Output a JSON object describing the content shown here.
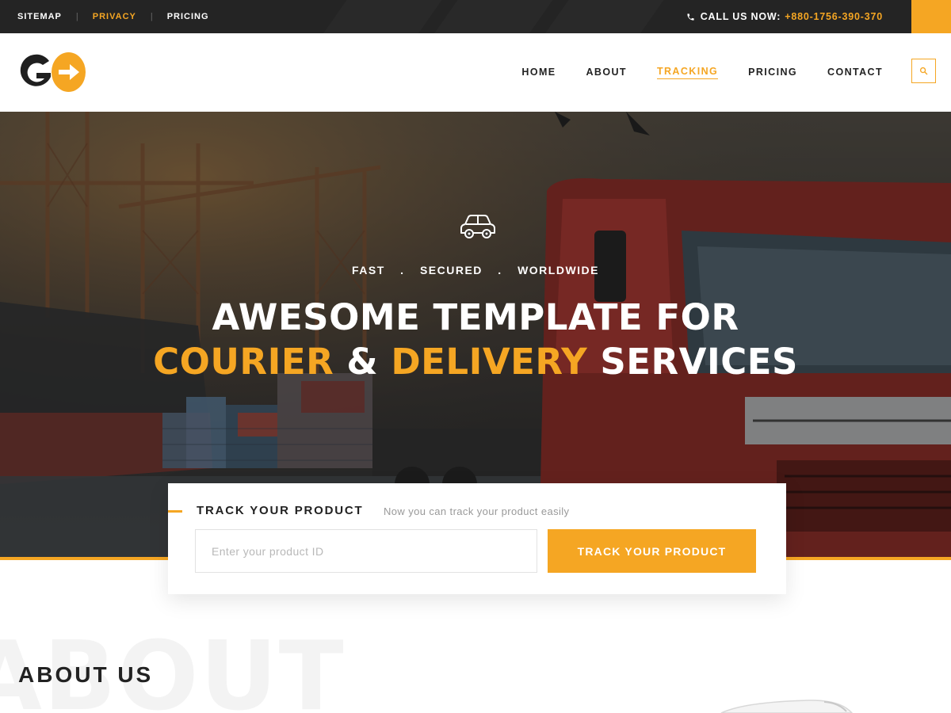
{
  "topbar": {
    "links": [
      "SITEMAP",
      "PRIVACY",
      "PRICING"
    ],
    "separator": "|",
    "call_label": "CALL US NOW:",
    "phone": "+880-1756-390-370"
  },
  "header": {
    "nav": [
      "HOME",
      "ABOUT",
      "TRACKING",
      "PRICING",
      "CONTACT"
    ],
    "active_nav": "TRACKING"
  },
  "hero": {
    "tagline": [
      "FAST",
      "SECURED",
      "WORLDWIDE"
    ],
    "tagline_dot": ".",
    "headline_line1": "AWESOME TEMPLATE FOR",
    "headline_word1": "COURIER",
    "headline_amp": "&",
    "headline_word2": "DELIVERY",
    "headline_word3": "SERVICES"
  },
  "tracking": {
    "title": "TRACK YOUR PRODUCT",
    "subtitle": "Now you can track your product easily",
    "input_placeholder": "Enter your product ID",
    "input_value": "",
    "button_label": "TRACK YOUR PRODUCT"
  },
  "about": {
    "ghost_text": "ABOUT",
    "title": "ABOUT US"
  },
  "icons": {
    "phone": "phone-icon",
    "search": "search-icon",
    "car": "car-icon"
  },
  "colors": {
    "accent": "#f5a623",
    "dark": "#242424",
    "text": "#222222"
  }
}
